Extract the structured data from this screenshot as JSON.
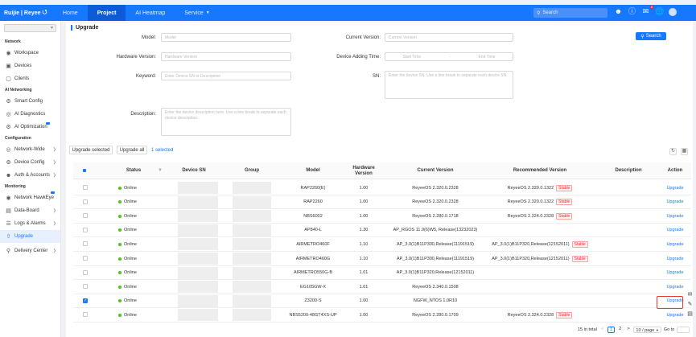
{
  "topbar": {
    "brand": "Ruijie | Reyee",
    "nav": [
      {
        "label": "Home"
      },
      {
        "label": "Project"
      },
      {
        "label": "AI Heatmap"
      },
      {
        "label": "Service"
      }
    ],
    "search_placeholder": "Search",
    "notification_count": "8"
  },
  "sidebar": {
    "sections": {
      "network": "Network",
      "ai": "AI Networking",
      "config": "Configuration",
      "monitoring": "Monitoring"
    },
    "items": [
      {
        "label": "Workspace"
      },
      {
        "label": "Devices"
      },
      {
        "label": "Clients"
      },
      {
        "label": "Smart Config"
      },
      {
        "label": "AI Diagnostics"
      },
      {
        "label": "AI Optimization"
      },
      {
        "label": "Network-Wide"
      },
      {
        "label": "Device Config"
      },
      {
        "label": "Auth & Accounts"
      },
      {
        "label": "Network HawkEye"
      },
      {
        "label": "Data-Board"
      },
      {
        "label": "Logs & Alarms"
      },
      {
        "label": "Upgrade"
      },
      {
        "label": "Delivery Center"
      }
    ]
  },
  "page": {
    "title": "Upgrade"
  },
  "filters": {
    "model_label": "Model:",
    "model_ph": "Model",
    "current_version_label": "Current Version:",
    "current_version_ph": "Current Version",
    "hw_label": "Hardware Version:",
    "hw_ph": "Hardware Version",
    "time_label": "Device Adding Time:",
    "start_ph": "Start Time",
    "end_ph": "End Time",
    "range_sep": "-",
    "keyword_label": "Keyword:",
    "keyword_ph": "Enter Device SN or Description",
    "sn_label": "SN:",
    "sn_ph": "Enter the device SN. Use a line break to separate each device SN.",
    "desc_label": "Description:",
    "desc_ph": "Enter the device description here. Use a line break to separate each device description.",
    "search_button": "Search"
  },
  "actions": {
    "upgrade_selected": "Upgrade selected",
    "upgrade_all": "Upgrade all",
    "selected_count": "1 selected"
  },
  "table": {
    "headers": {
      "status": "Status",
      "sn": "Device SN",
      "group": "Group",
      "model": "Model",
      "hw": "Hardware Version",
      "current": "Current Version",
      "recommended": "Recommended Version",
      "description": "Description",
      "action": "Action"
    },
    "rows": [
      {
        "status": "Online",
        "model": "RAP2260(E)",
        "hw": "1.00",
        "current": "ReyeeOS 2.320.0.2328",
        "recommended": "ReyeeOS 2.320.0.1322",
        "tag": "Stable",
        "action": "Upgrade",
        "checked": false
      },
      {
        "status": "Online",
        "model": "RAP2260",
        "hw": "1.00",
        "current": "ReyeeOS 2.320.0.2328",
        "recommended": "ReyeeOS 2.320.0.1322",
        "tag": "Stable",
        "action": "Upgrade",
        "checked": false
      },
      {
        "status": "Online",
        "model": "NBS6002",
        "hw": "1.00",
        "current": "ReyeeOS 2.280.0.1718",
        "recommended": "ReyeeOS 2.324.0.2328",
        "tag": "Stable",
        "action": "Upgrade",
        "checked": false
      },
      {
        "status": "Online",
        "model": "AP840-L",
        "hw": "1.30",
        "current": "AP_RGOS 11.9(6)W5, Release(13232023)",
        "recommended": "",
        "tag": "",
        "action": "Upgrade",
        "checked": false
      },
      {
        "status": "Online",
        "model": "AIRMETRO460F",
        "hw": "1.10",
        "current": "AP_3.0(1)B11P300,Release(11191519)",
        "recommended": "AP_3.0(1)B11P320,Release(12152011)",
        "tag": "Stable",
        "action": "Upgrade",
        "checked": false
      },
      {
        "status": "Online",
        "model": "AIRMETRO460G",
        "hw": "1.10",
        "current": "AP_3.0(1)B11P300,Release(11191519)",
        "recommended": "AP_3.0(1)B11P320,Release(12152011)",
        "tag": "Stable",
        "action": "Upgrade",
        "checked": false
      },
      {
        "status": "Online",
        "model": "AIRMETRO550G-B",
        "hw": "1.01",
        "current": "AP_3.0(1)B11P320,Release(12152011)",
        "recommended": "",
        "tag": "",
        "action": "Upgrade",
        "checked": false
      },
      {
        "status": "Online",
        "model": "EG105GW-X",
        "hw": "1.01",
        "current": "ReyeeOS 2.340.0.1508",
        "recommended": "",
        "tag": "",
        "action": "Upgrade",
        "checked": false
      },
      {
        "status": "Online",
        "model": "Z3200-S",
        "hw": "1.00",
        "current": "NGFW_NTOS 1.0R10",
        "recommended": "",
        "tag": "",
        "action": "Upgrade",
        "checked": true
      },
      {
        "status": "Online",
        "model": "NBS5200-48GT4XS-UP",
        "hw": "1.00",
        "current": "ReyeeOS 2.280.0.1709",
        "recommended": "ReyeeOS 2.324.0.2328",
        "tag": "Stable",
        "action": "Upgrade",
        "checked": false
      }
    ]
  },
  "pagination": {
    "total": "15 in total",
    "prev": "<",
    "pages": [
      "1",
      "2"
    ],
    "next": ">",
    "page_size": "10 / page",
    "goto": "Go to"
  },
  "colors": {
    "primary": "#1677ff",
    "online": "#52c41a",
    "stable": "#f5222d",
    "highlight": "#e53935"
  }
}
